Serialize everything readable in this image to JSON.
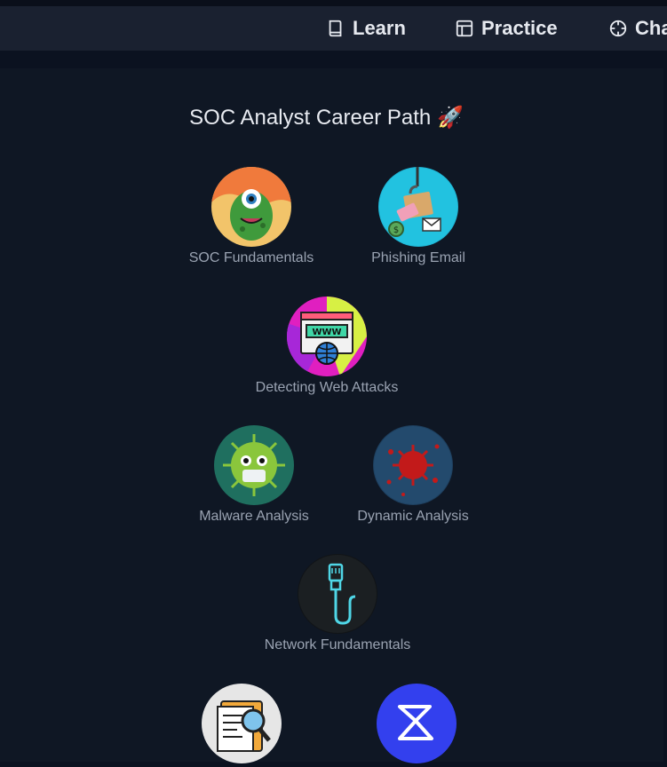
{
  "nav": {
    "items": [
      {
        "label": "Learn",
        "icon": "book-icon"
      },
      {
        "label": "Practice",
        "icon": "layout-icon"
      },
      {
        "label": "Cha",
        "icon": "crosshair-icon"
      }
    ]
  },
  "career_path": {
    "title": "SOC Analyst Career Path 🚀",
    "modules": [
      {
        "label": "SOC Fundamentals",
        "icon": "green-monster-icon"
      },
      {
        "label": "Phishing Email",
        "icon": "phishing-hook-icon"
      },
      {
        "label": "Detecting Web Attacks",
        "icon": "web-browser-globe-icon"
      },
      {
        "label": "Malware Analysis",
        "icon": "green-virus-icon"
      },
      {
        "label": "Dynamic Analysis",
        "icon": "red-virus-icon"
      },
      {
        "label": "Network Fundamentals",
        "icon": "network-cable-icon"
      },
      {
        "label": "",
        "icon": "document-magnifier-icon"
      },
      {
        "label": "",
        "icon": "sigma-icon"
      }
    ]
  },
  "colors": {
    "background": "#0b1220",
    "panel": "#0f1724",
    "navbar": "#1a2130",
    "label": "#9aa3b2",
    "title": "#e8ebf1",
    "sigma_blue": "#3340ee"
  }
}
